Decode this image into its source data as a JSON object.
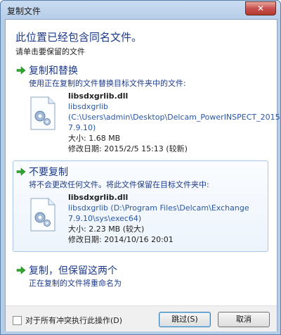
{
  "window": {
    "title": "复制文件",
    "close_label": "✕"
  },
  "header": {
    "heading": "此位置已经包含同名文件。",
    "subheading": "请单击要保留的文件"
  },
  "options": [
    {
      "title": "复制和替换",
      "description": "使用正在复制的文件替换目标文件夹中的文件:",
      "file": {
        "name": "libsdxgrlib.dll",
        "path_lines": [
          "libsdxgrlib",
          "(C:\\Users\\admin\\Desktop\\Delcam_PowerINSPECT_2015",
          "7.9.10)"
        ],
        "size": "大小: 1.68 MB",
        "date": "修改日期: 2015/2/5 15:13 (较新)"
      }
    },
    {
      "title": "不要复制",
      "description": "将不会更改任何文件。将此文件保留在目标文件夹中:",
      "file": {
        "name": "libsdxgrlib.dll",
        "path_lines": [
          "libsdxgrlib (D:\\Program Files\\Delcam\\Exchange",
          "7.9.10\\sys\\exec64)"
        ],
        "size": "大小: 2.23 MB (较大)",
        "date": "修改日期: 2014/10/16 20:01"
      }
    },
    {
      "title": "复制，但保留这两个",
      "description": "正在复制的文件将重命名为"
    }
  ],
  "footer": {
    "checkbox_label": "对于所有冲突执行此操作(D)",
    "skip_label": "跳过(S)",
    "cancel_label": "取消"
  },
  "colors": {
    "accent_text": "#1c3a8a",
    "link_text": "#2a57a6",
    "arrow_green": "#2fa52f"
  },
  "icons": {
    "arrow": "green-right-arrow-icon",
    "file": "dll-gear-file-icon"
  }
}
